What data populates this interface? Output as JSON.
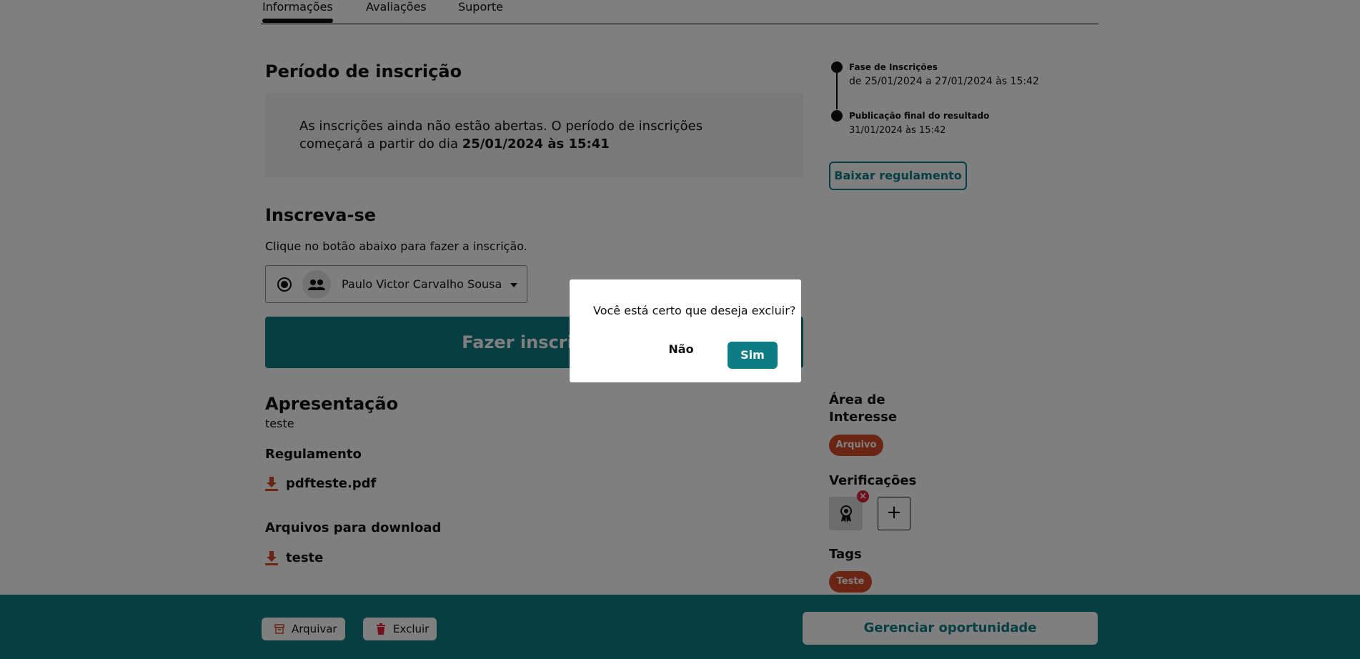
{
  "tabs": [
    {
      "label": "Informações",
      "active": true
    },
    {
      "label": "Avaliações",
      "active": false
    },
    {
      "label": "Suporte",
      "active": false
    }
  ],
  "registration": {
    "title": "Período de inscrição",
    "notice_text": "As inscrições ainda não estão abertas. O período de inscrições começará a partir do dia ",
    "notice_date": "25/01/2024 às 15:41"
  },
  "subscribe": {
    "title": "Inscreva-se",
    "hint": "Clique no botão abaixo para fazer a inscrição.",
    "agent_name": "Paulo Victor Carvalho Sousa",
    "button_label": "Fazer inscrição"
  },
  "presentation": {
    "title": "Apresentação",
    "text": "teste"
  },
  "rules": {
    "title": "Regulamento",
    "file": "pdfteste.pdf"
  },
  "downloads": {
    "title": "Arquivos para download",
    "file": "teste"
  },
  "timeline": [
    {
      "title": "Fase de Inscrições",
      "date": "de 25/01/2024 a 27/01/2024 às 15:42"
    },
    {
      "title": "Publicação final do resultado",
      "date": "31/01/2024 às 15:42"
    }
  ],
  "sidebar": {
    "download_rules_label": "Baixar regulamento",
    "area_title_line1": "Área de",
    "area_title_line2": "Interesse",
    "area_tag": "Arquivo",
    "verifications_title": "Verificações",
    "add_label": "+",
    "tags_title": "Tags",
    "tag": "Teste"
  },
  "footer": {
    "archive_label": "Arquivar",
    "delete_label": "Excluir",
    "manage_label": "Gerenciar oportunidade"
  },
  "modal": {
    "message": "Você está certo que deseja excluir?",
    "no_label": "Não",
    "yes_label": "Sim"
  },
  "colors": {
    "accent": "#0c7d84",
    "tag": "#d64a2b",
    "danger": "#e0203a"
  }
}
